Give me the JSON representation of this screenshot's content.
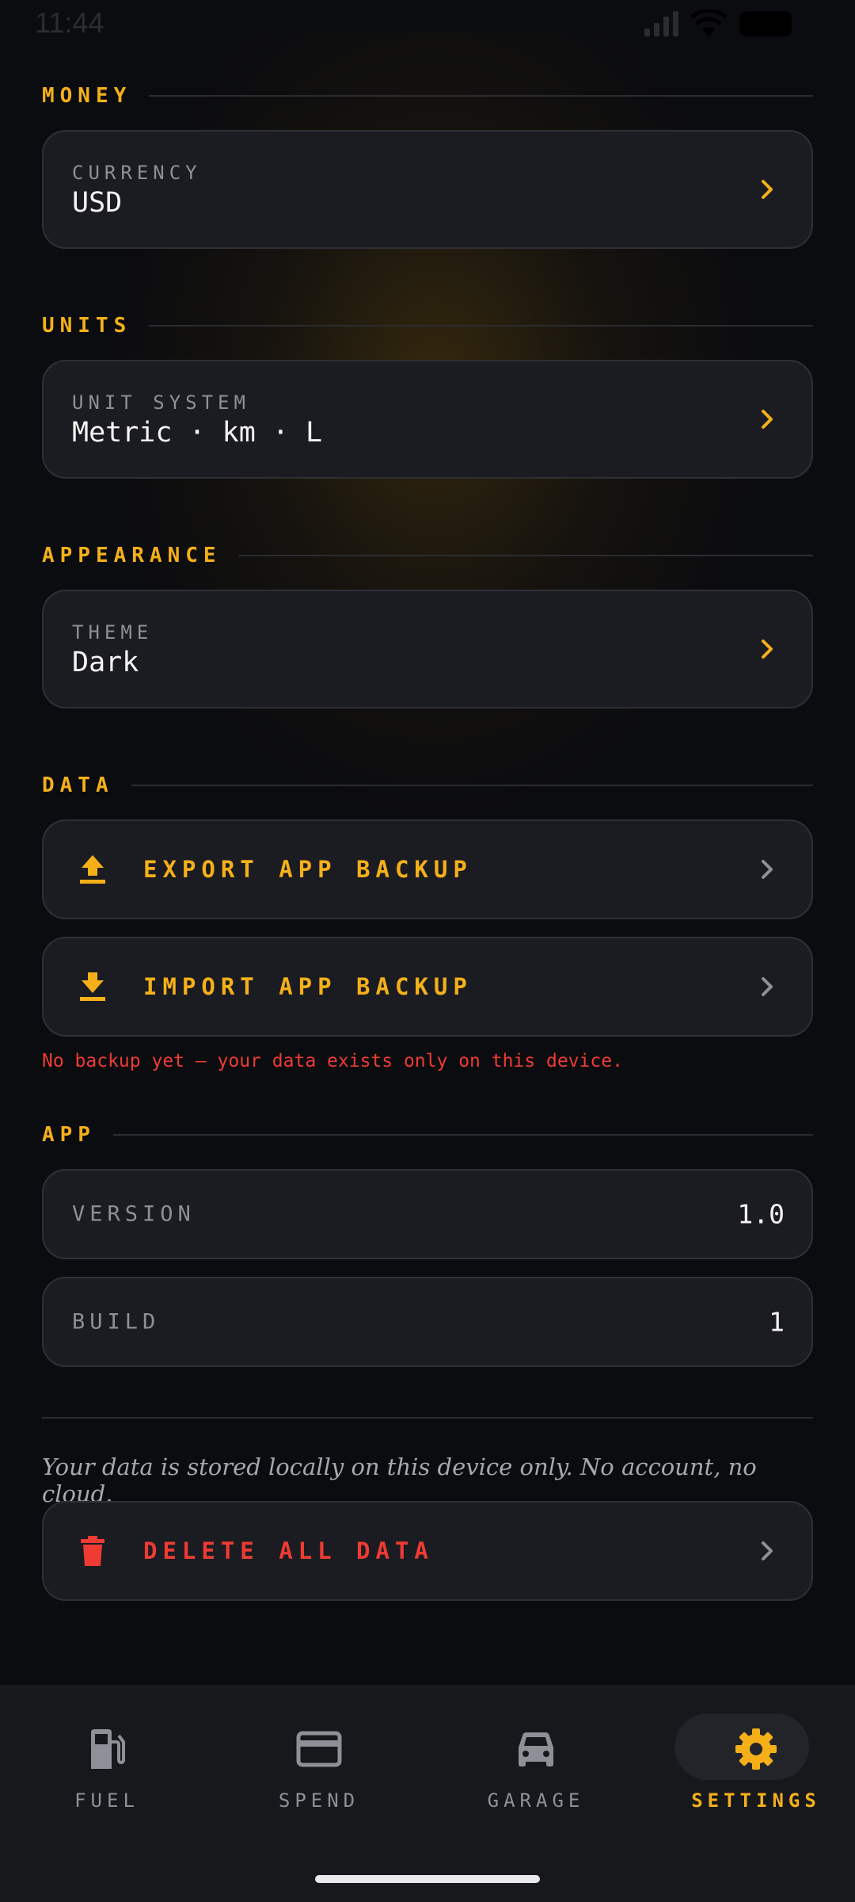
{
  "status_bar": {
    "time": "11:44"
  },
  "sections": {
    "money": {
      "title": "MONEY",
      "currency": {
        "label": "CURRENCY",
        "value": "USD"
      }
    },
    "units": {
      "title": "UNITS",
      "unit_system": {
        "label": "UNIT SYSTEM",
        "value": "Metric · km · L"
      }
    },
    "appearance": {
      "title": "APPEARANCE",
      "theme": {
        "label": "THEME",
        "value": "Dark"
      }
    },
    "data": {
      "title": "DATA",
      "export_label": "EXPORT APP BACKUP",
      "import_label": "IMPORT APP BACKUP",
      "warning": "No backup yet — your data exists only on this device."
    },
    "app": {
      "title": "APP",
      "version": {
        "label": "VERSION",
        "value": "1.0"
      },
      "build": {
        "label": "BUILD",
        "value": "1"
      }
    }
  },
  "footer_note": "Your data is stored locally on this device only. No account, no cloud.",
  "delete_label": "DELETE ALL DATA",
  "nav": {
    "items": [
      {
        "label": "FUEL",
        "icon": "fuel-pump-icon"
      },
      {
        "label": "SPEND",
        "icon": "credit-card-icon"
      },
      {
        "label": "GARAGE",
        "icon": "car-icon"
      },
      {
        "label": "SETTINGS",
        "icon": "gear-icon"
      }
    ],
    "active": "SETTINGS"
  },
  "colors": {
    "accent": "#f5b019",
    "danger": "#ee3b33",
    "background": "#0b0c0f",
    "card": "#1b1c21"
  }
}
